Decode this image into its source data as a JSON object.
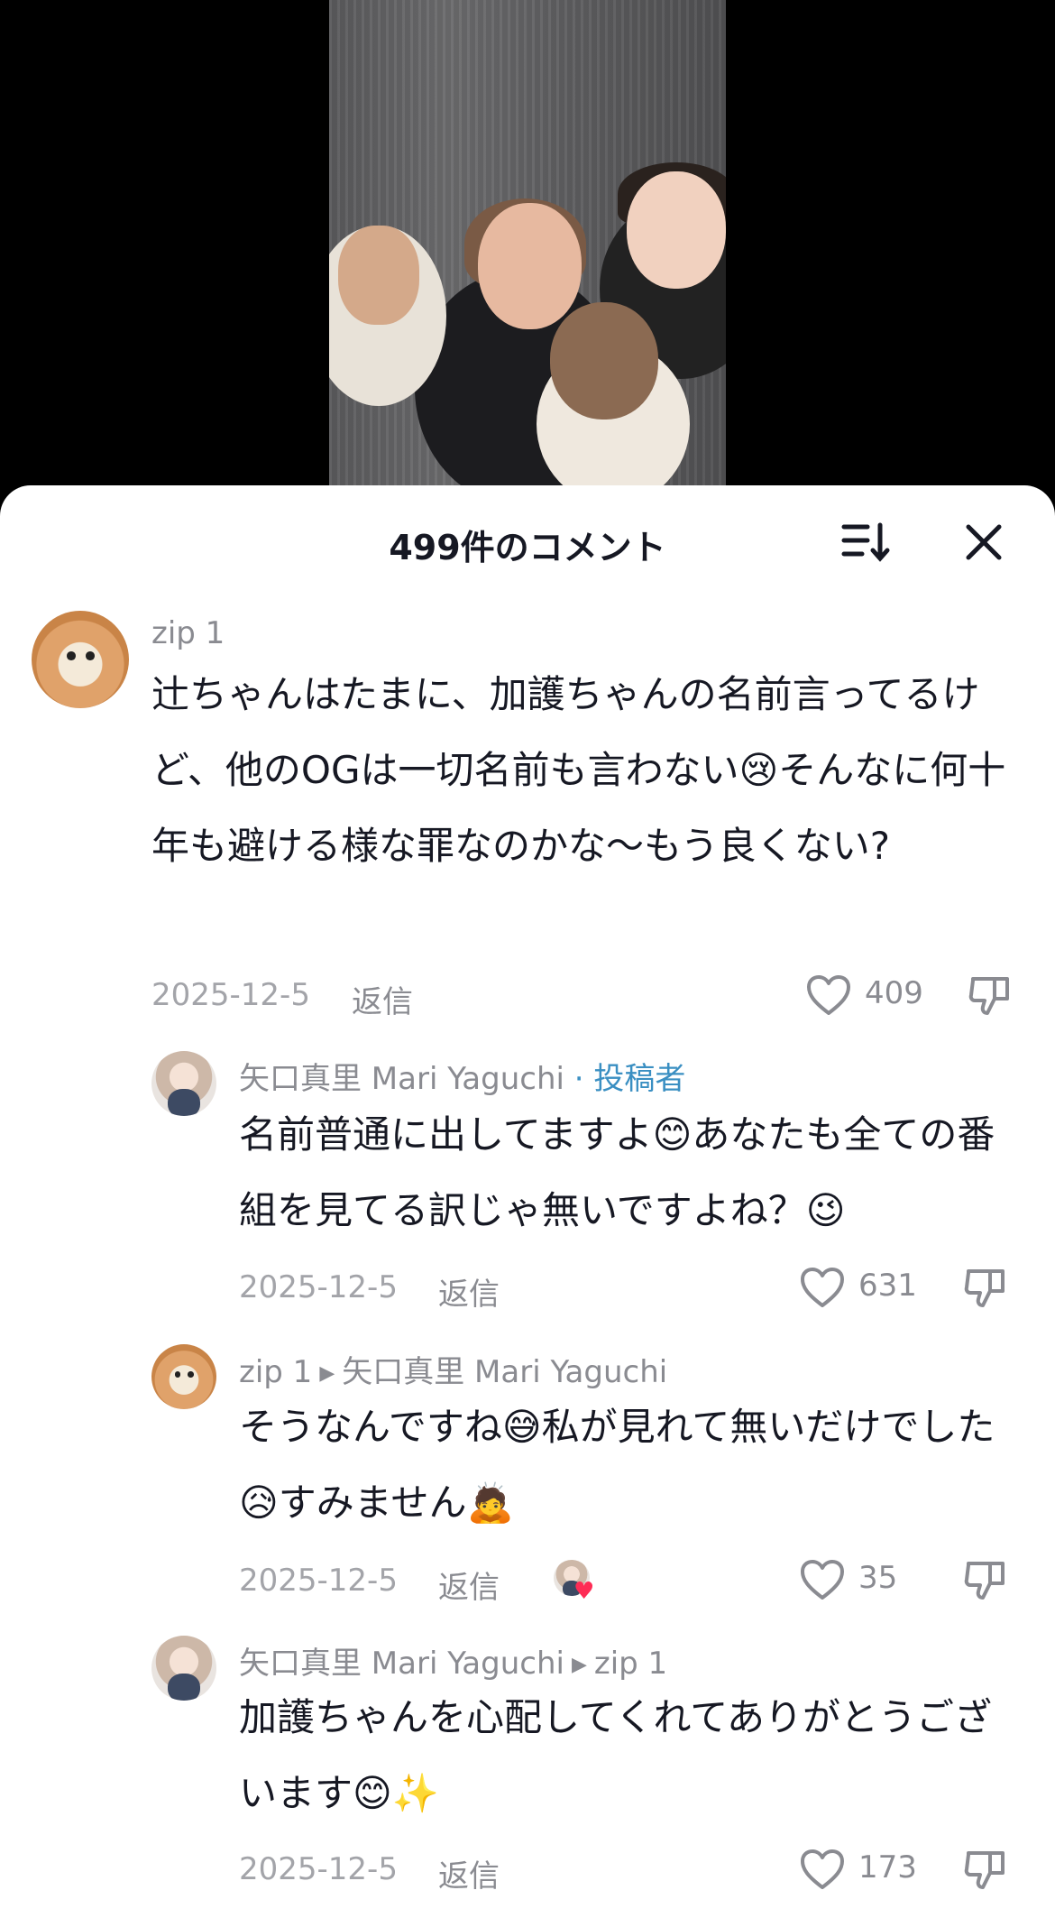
{
  "header": {
    "title": "499件のコメント"
  },
  "comments": [
    {
      "user": "zip 1",
      "text": "辻ちゃんはたまに、加護ちゃんの名前言ってるけど、他のOGは一切名前も言わない😢そんなに何十年も避ける様な罪なのかな〜もう良くない?",
      "date": "2025-12-5",
      "reply_label": "返信",
      "likes": "409"
    },
    {
      "user": "矢口真里 Mari Yaguchi",
      "author_badge": "· 投稿者",
      "text": "名前普通に出してますよ😊あなたも全ての番組を見てる訳じゃ無いですよね？😉",
      "date": "2025-12-5",
      "reply_label": "返信",
      "likes": "631"
    },
    {
      "user": "zip 1",
      "reply_to": "矢口真里 Mari Yaguchi",
      "text": "そうなんですね😅私が見れて無いだけでした😥すみません🙇",
      "date": "2025-12-5",
      "reply_label": "返信",
      "likes": "35",
      "creator_liked": "♥"
    },
    {
      "user": "矢口真里 Mari Yaguchi",
      "reply_to": "zip 1",
      "text": "加護ちゃんを心配してくれてありがとうございます😊✨",
      "date": "2025-12-5",
      "reply_label": "返信",
      "likes": "173"
    }
  ],
  "colors": {
    "author": "#3a8fc2",
    "text": "#161823",
    "muted": "#8a8b91",
    "like_heart": "#fe2c55"
  },
  "icons": [
    "sort-icon",
    "close-icon",
    "heart-icon",
    "dislike-icon"
  ]
}
